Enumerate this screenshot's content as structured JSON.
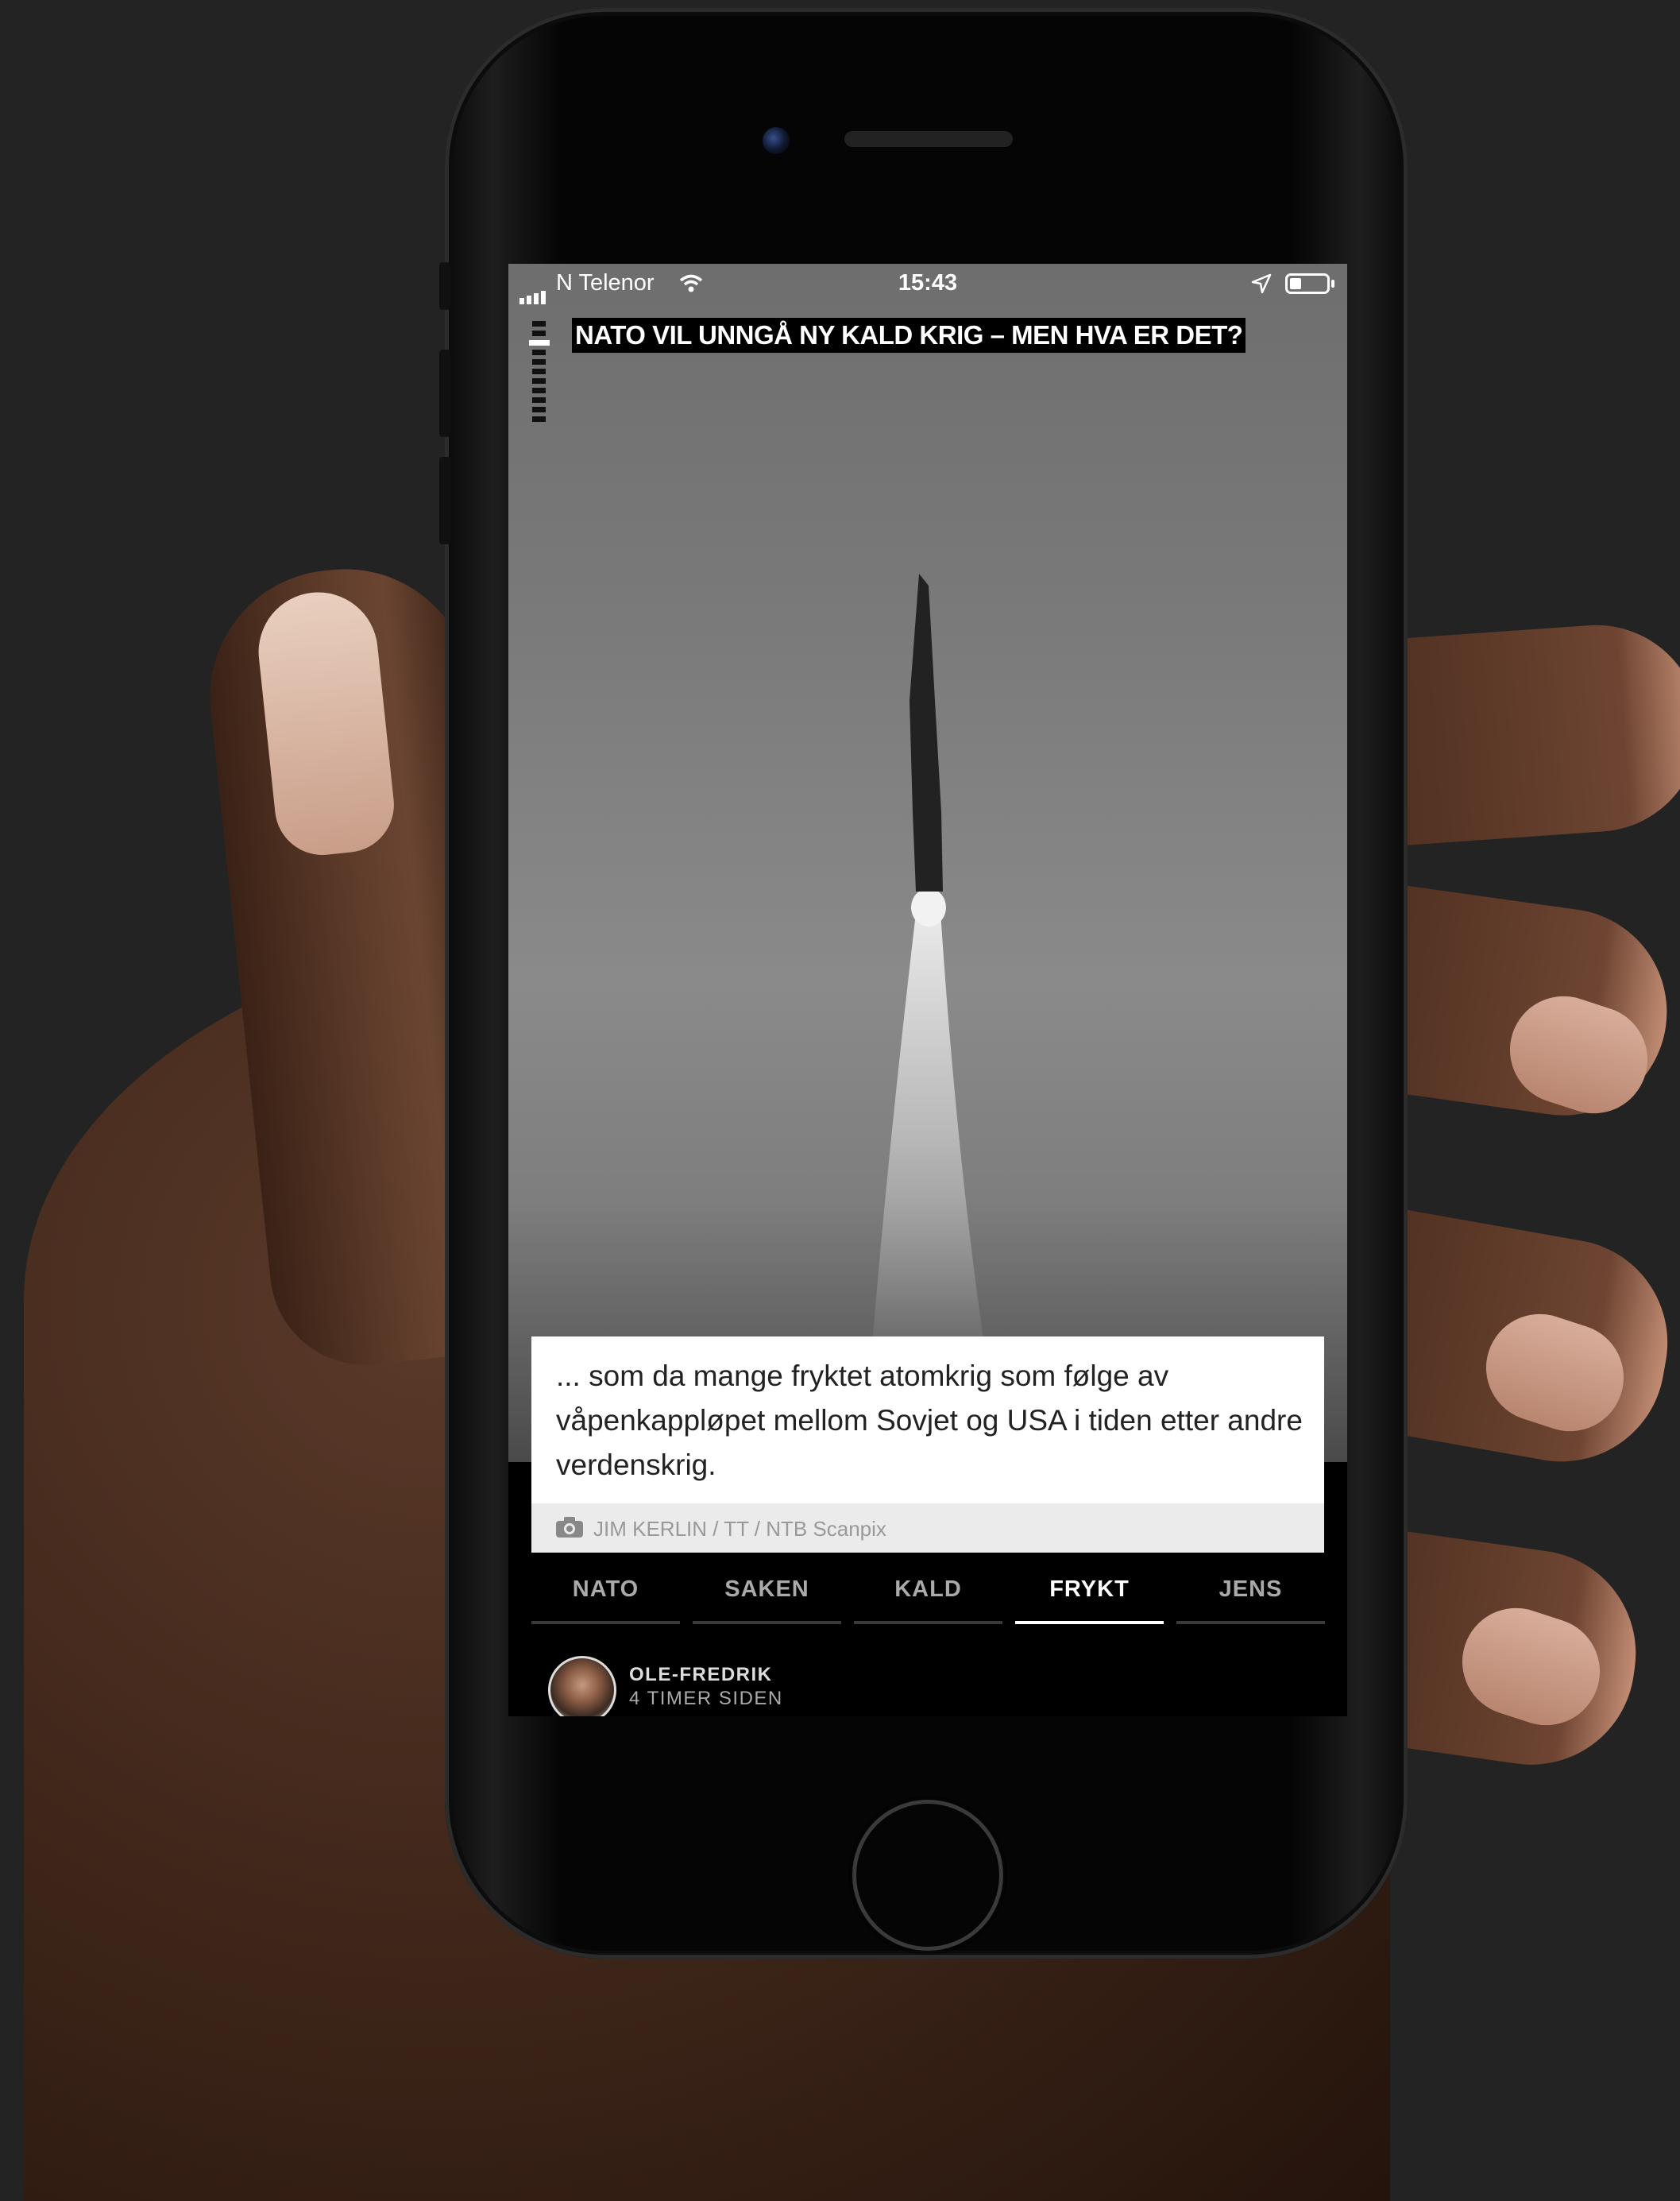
{
  "status_bar": {
    "carrier": "N Telenor",
    "time": "15:43"
  },
  "story": {
    "headline": "NATO VIL UNNGÅ NY KALD KRIG – MEN HVA ER DET?",
    "progress": {
      "total_segments": 11,
      "current_segment": 3
    },
    "caption": "... som da mange fryktet atomkrig som følge av våpenkappløpet mellom Sovjet og USA i tiden etter andre verdenskrig.",
    "photo_credit": "JIM KERLIN / TT / NTB Scanpix"
  },
  "tabs": [
    {
      "label": "NATO",
      "active": false
    },
    {
      "label": "SAKEN",
      "active": false
    },
    {
      "label": "KALD",
      "active": false
    },
    {
      "label": "FRYKT",
      "active": true
    },
    {
      "label": "JENS",
      "active": false
    }
  ],
  "author": {
    "name": "OLE-FREDRIK",
    "time_ago": "4 TIMER SIDEN"
  },
  "icons": [
    "signal-icon",
    "wifi-icon",
    "location-icon",
    "battery-icon",
    "camera-icon"
  ],
  "colors": {
    "background": "#232323",
    "caption_bg": "#ffffff",
    "credit_bg": "#ebebeb",
    "tab_active": "#ffffff",
    "tab_inactive": "#aaaaaa"
  }
}
